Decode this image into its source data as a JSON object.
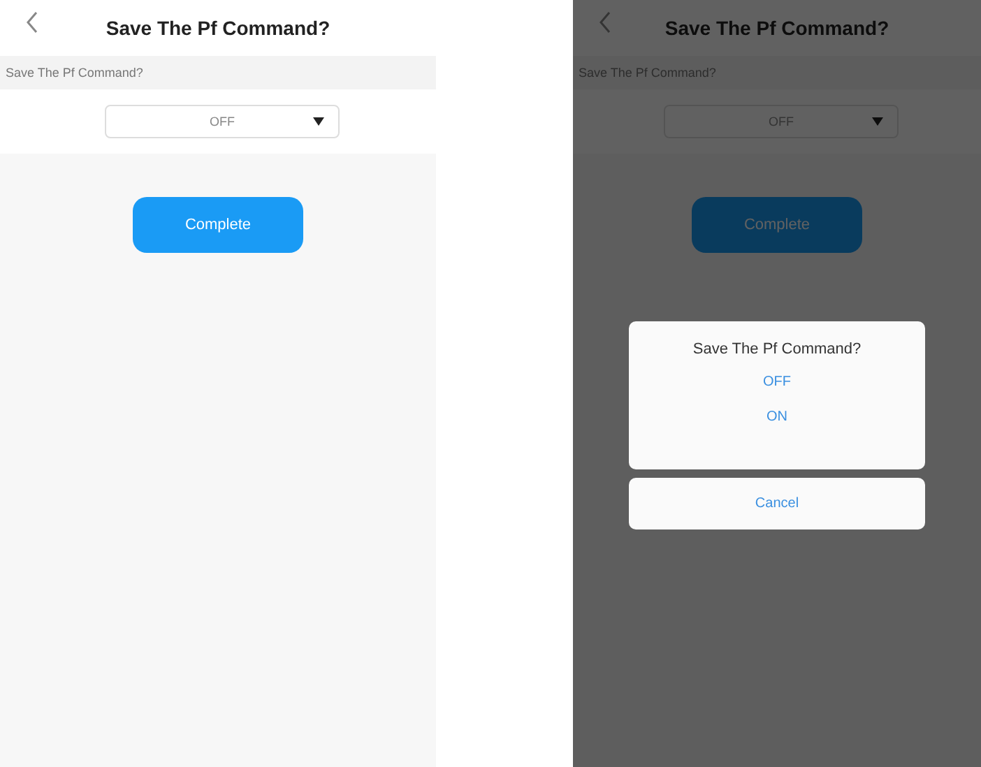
{
  "screens": [
    {
      "title": "Save The Pf Command?",
      "setting_label": "Save The Pf Command?",
      "select_value": "OFF",
      "button": "Complete",
      "dimmed": false
    },
    {
      "title": "Save The Pf Command?",
      "setting_label": "Save The Pf Command?",
      "select_value": "OFF",
      "button": "Complete",
      "dimmed": true,
      "action_sheet": {
        "title": "Save The Pf Command?",
        "options": [
          "OFF",
          "ON"
        ],
        "cancel": "Cancel"
      }
    }
  ]
}
